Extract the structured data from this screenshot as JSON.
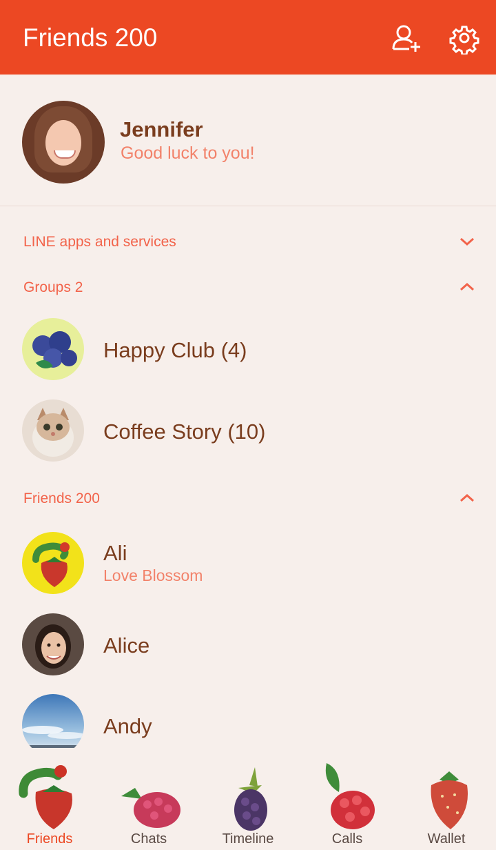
{
  "header": {
    "title": "Friends 200",
    "add_friend_icon": "add-friend-icon",
    "settings_icon": "gear-icon"
  },
  "profile": {
    "name": "Jennifer",
    "status": "Good luck to you!"
  },
  "sections": {
    "services": {
      "label": "LINE apps and services",
      "state": "collapsed"
    },
    "groups": {
      "label": "Groups 2",
      "state": "expanded"
    },
    "friends": {
      "label": "Friends 200",
      "state": "expanded"
    }
  },
  "groups": [
    {
      "name": "Happy Club (4)",
      "avatar": "blueberries"
    },
    {
      "name": "Coffee Story (10)",
      "avatar": "cat"
    }
  ],
  "friends": [
    {
      "name": "Ali",
      "status": "Love Blossom",
      "avatar": "caterpillar-strawberry"
    },
    {
      "name": "Alice",
      "status": "",
      "avatar": "woman-photo"
    },
    {
      "name": "Andy",
      "status": "",
      "avatar": "sky-photo"
    }
  ],
  "tabs": [
    {
      "label": "Friends",
      "active": true
    },
    {
      "label": "Chats",
      "active": false
    },
    {
      "label": "Timeline",
      "active": false
    },
    {
      "label": "Calls",
      "active": false
    },
    {
      "label": "Wallet",
      "active": false
    }
  ],
  "colors": {
    "accent": "#ec4823",
    "background": "#f7efeb",
    "name_text": "#7a3d1e",
    "status_text": "#f2826a",
    "section_text": "#f2634a"
  }
}
